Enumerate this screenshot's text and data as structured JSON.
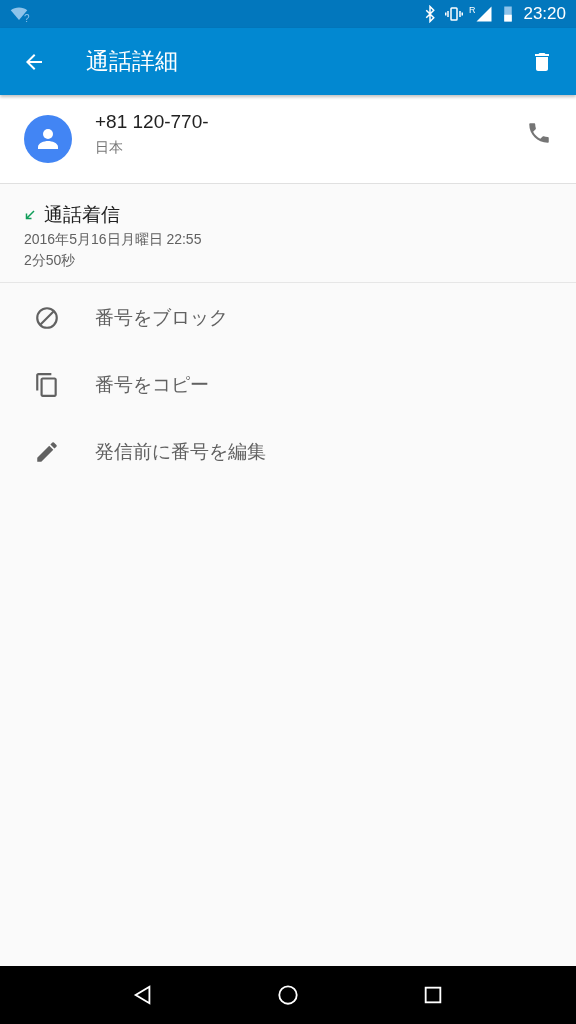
{
  "status_bar": {
    "time": "23:20",
    "wifi_badge": "?",
    "roaming_badge": "R"
  },
  "app_bar": {
    "title": "通話詳細"
  },
  "contact": {
    "number": "+81 120-770-",
    "location": "日本"
  },
  "call": {
    "kind": "incoming",
    "label": "通話着信",
    "datetime": "2016年5月16日月曜日 22:55",
    "duration": "2分50秒"
  },
  "actions": [
    {
      "kind": "block",
      "label": "番号をブロック"
    },
    {
      "kind": "copy",
      "label": "番号をコピー"
    },
    {
      "kind": "edit",
      "label": "発信前に番号を編集"
    }
  ]
}
